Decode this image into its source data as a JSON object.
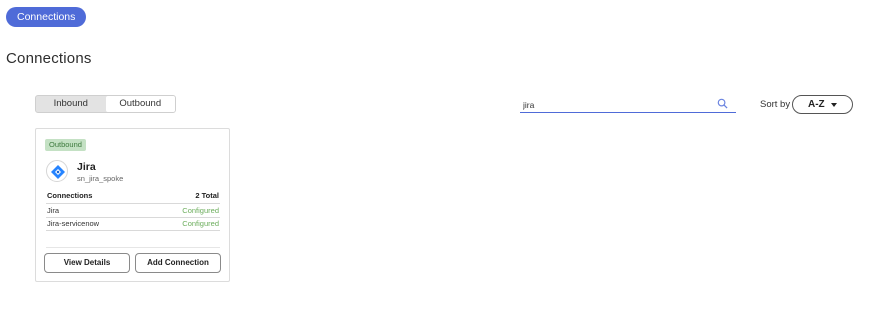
{
  "breadcrumb": {
    "label": "Connections"
  },
  "page": {
    "title": "Connections"
  },
  "direction_toggle": {
    "options": [
      "Inbound",
      "Outbound"
    ],
    "selected": "Outbound"
  },
  "search": {
    "value": "jira",
    "icon": "search-icon"
  },
  "sort": {
    "label": "Sort by",
    "value": "A-Z"
  },
  "cards": [
    {
      "badge": "Outbound",
      "logo": "jira-logo-icon",
      "name": "Jira",
      "id": "sn_jira_spoke",
      "connections_header": "Connections",
      "total": "2 Total",
      "rows": [
        {
          "name": "Jira",
          "status": "Configured"
        },
        {
          "name": "Jira-servicenow",
          "status": "Configured"
        }
      ],
      "actions": {
        "view": "View Details",
        "add": "Add Connection"
      }
    }
  ],
  "colors": {
    "accent": "#4f6bd8",
    "status_ok": "#6bad5b",
    "badge_bg": "#c4e1c4"
  }
}
